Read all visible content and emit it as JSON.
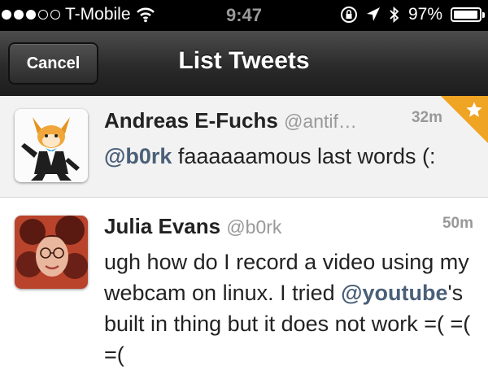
{
  "status_bar": {
    "signal_filled": 3,
    "signal_total": 5,
    "carrier": "T-Mobile",
    "time": "9:47",
    "battery": "97%",
    "battery_level": 0.97
  },
  "nav": {
    "cancel_label": "Cancel",
    "title": "List Tweets"
  },
  "tweets": [
    {
      "name": "Andreas E-Fuchs",
      "handle": "@antif…",
      "time": "32m",
      "mention": "@b0rk",
      "text": " faaaaaamous last words (:",
      "favorited": true
    },
    {
      "name": "Julia Evans",
      "handle": "@b0rk",
      "time": "50m",
      "text_before": "ugh how do I record a video using my webcam on linux. I tried ",
      "mention": "@youtube",
      "text_after": "'s built in thing but it does not work =( =( =("
    }
  ],
  "colors": {
    "favorite_corner": "#f0a424",
    "mention": "#4a5f78"
  }
}
